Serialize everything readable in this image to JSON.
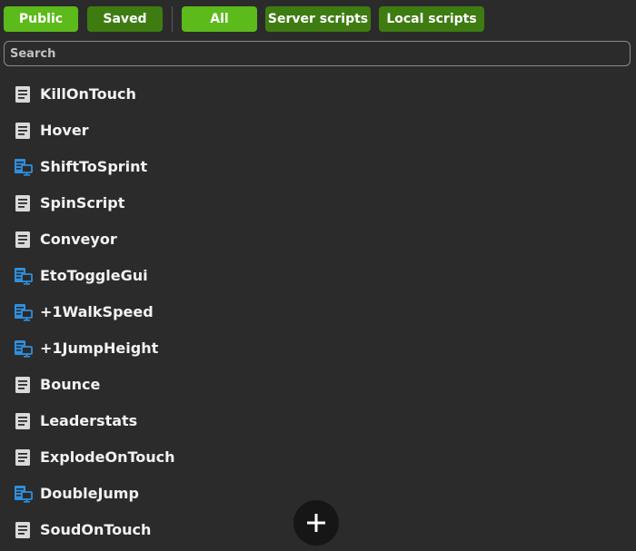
{
  "toolbar": {
    "filters": [
      {
        "label": "Public",
        "state": "active"
      },
      {
        "label": "Saved",
        "state": "inactive"
      },
      {
        "label": "All",
        "state": "active"
      },
      {
        "label": "Server scripts",
        "state": "inactive"
      },
      {
        "label": "Local scripts",
        "state": "inactive"
      }
    ]
  },
  "search": {
    "placeholder": "Search",
    "value": ""
  },
  "scripts": [
    {
      "name": "KillOnTouch",
      "icon": "server-script-icon"
    },
    {
      "name": "Hover",
      "icon": "server-script-icon"
    },
    {
      "name": "ShiftToSprint",
      "icon": "local-script-icon"
    },
    {
      "name": "SpinScript",
      "icon": "server-script-icon"
    },
    {
      "name": "Conveyor",
      "icon": "server-script-icon"
    },
    {
      "name": "EtoToggleGui",
      "icon": "local-script-icon"
    },
    {
      "name": "+1WalkSpeed",
      "icon": "local-script-icon"
    },
    {
      "name": "+1JumpHeight",
      "icon": "local-script-icon"
    },
    {
      "name": "Bounce",
      "icon": "server-script-icon"
    },
    {
      "name": "Leaderstats",
      "icon": "server-script-icon"
    },
    {
      "name": "ExplodeOnTouch",
      "icon": "server-script-icon"
    },
    {
      "name": "DoubleJump",
      "icon": "local-script-icon"
    },
    {
      "name": "SoudOnTouch",
      "icon": "server-script-icon"
    }
  ],
  "add_button": {
    "icon": "plus-icon"
  },
  "colors": {
    "background": "#2b2b2b",
    "filter_active": "#5cba1a",
    "filter_inactive": "#3e7c12",
    "local_icon": "#2f8fdd",
    "server_icon": "#d9d9d9",
    "add_button": "#161616"
  }
}
